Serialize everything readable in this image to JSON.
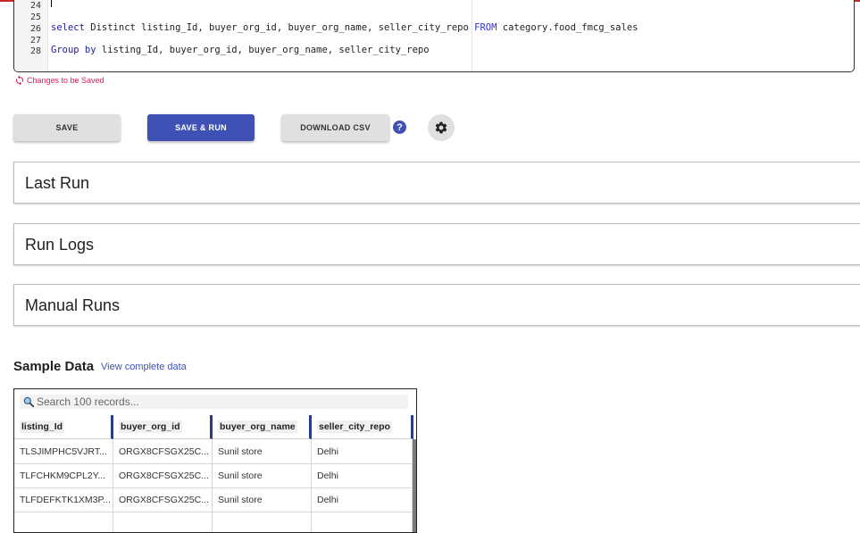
{
  "editor": {
    "line_numbers": [
      "24",
      "25",
      "26",
      "27",
      "28"
    ],
    "line26": {
      "kw_select": "select",
      "text_mid": " Distinct listing_Id, buyer_org_id, buyer_org_name, seller_city_repo ",
      "kw_from": "FROM",
      "text_end": " category.food_fmcg_sales"
    },
    "line28": {
      "kw_group": "Group by",
      "text_end": " listing_Id, buyer_org_id, buyer_org_name, seller_city_repo"
    }
  },
  "status": {
    "changes_text": "Changes to be Saved",
    "icon": "sync-icon"
  },
  "actions": {
    "save_label": "SAVE",
    "save_run_label": "SAVE & RUN",
    "download_label": "DOWNLOAD CSV",
    "help_label": "?"
  },
  "panels": {
    "last_run": "Last Run",
    "run_logs": "Run Logs",
    "manual_runs": "Manual Runs"
  },
  "sample": {
    "title": "Sample Data",
    "view_link": "View complete data",
    "search_placeholder": "Search 100 records...",
    "columns": [
      "listing_Id",
      "buyer_org_id",
      "buyer_org_name",
      "seller_city_repo"
    ],
    "rows": [
      [
        "TLSJIMPHC5VJRT...",
        "ORGX8CFSGX25C...",
        "Sunil store",
        "Delhi"
      ],
      [
        "TLFCHKM9CPL2Y...",
        "ORGX8CFSGX25C...",
        "Sunil store",
        "Delhi"
      ],
      [
        "TLFDEFKTK1XM3P...",
        "ORGX8CFSGX25C...",
        "Sunil store",
        "Delhi"
      ],
      [
        "",
        "",
        "",
        ""
      ]
    ]
  },
  "colors": {
    "primary": "#3f51b5",
    "alert": "#d81b60",
    "top_bar": "#c62828"
  }
}
